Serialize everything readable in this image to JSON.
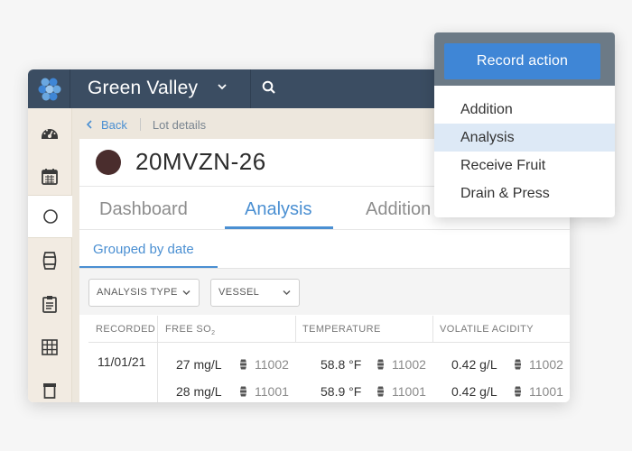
{
  "app": {
    "title": "Green Valley",
    "colors": {
      "topbar": "#3b4d62",
      "accent": "#4a8fd2",
      "lot_color": "#4a2d2d",
      "sidebar": "#f2ebe2"
    }
  },
  "sidebar": {
    "items": [
      {
        "icon": "gauge-icon"
      },
      {
        "icon": "calendar-icon"
      },
      {
        "icon": "circle-icon",
        "active": true
      },
      {
        "icon": "barrel-icon"
      },
      {
        "icon": "clipboard-icon"
      },
      {
        "icon": "grid-icon"
      },
      {
        "icon": "bin-icon"
      }
    ]
  },
  "breadcrumb": {
    "back": "Back",
    "current": "Lot details"
  },
  "lot": {
    "name": "20MVZN-26"
  },
  "tabs": [
    {
      "label": "Dashboard"
    },
    {
      "label": "Analysis",
      "active": true
    },
    {
      "label": "Addition"
    }
  ],
  "subtab": {
    "label": "Grouped by date"
  },
  "filters": [
    {
      "label": "ANALYSIS TYPE"
    },
    {
      "label": "VESSEL"
    }
  ],
  "table": {
    "headers": [
      "RECORDED",
      "FREE SO",
      "TEMPERATURE",
      "VOLATILE ACIDITY"
    ],
    "free_so_subscript": "2",
    "date": "11/01/21",
    "rows": [
      {
        "free_so": "27 mg/L",
        "free_so_vessel": "11002",
        "temp": "58.8 °F",
        "temp_vessel": "11002",
        "va": "0.42 g/L",
        "va_vessel": "11002"
      },
      {
        "free_so": "28 mg/L",
        "free_so_vessel": "11001",
        "temp": "58.9 °F",
        "temp_vessel": "11001",
        "va": "0.42 g/L",
        "va_vessel": "11001"
      }
    ]
  },
  "dropdown": {
    "button": "Record action",
    "items": [
      {
        "label": "Addition"
      },
      {
        "label": "Analysis",
        "highlighted": true
      },
      {
        "label": "Receive Fruit"
      },
      {
        "label": "Drain & Press"
      }
    ]
  }
}
